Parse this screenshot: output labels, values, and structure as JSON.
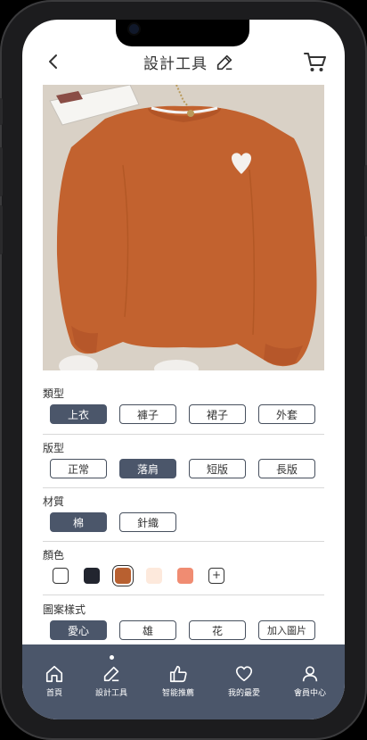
{
  "header": {
    "title": "設計工具"
  },
  "sections": [
    {
      "label": "類型",
      "options": [
        "上衣",
        "褲子",
        "裙子",
        "外套"
      ],
      "selected": 0
    },
    {
      "label": "版型",
      "options": [
        "正常",
        "落肩",
        "短版",
        "長版"
      ],
      "selected": 1
    },
    {
      "label": "材質",
      "options": [
        "棉",
        "針織"
      ],
      "selected": 0
    },
    {
      "label": "圖案樣式",
      "options": [
        "愛心",
        "雄",
        "花",
        "加入圖片"
      ],
      "selected": 0
    }
  ],
  "color": {
    "label": "顏色",
    "swatches": [
      "#ffffff",
      "#22252f",
      "#b86030",
      "#fde9dc",
      "#f08c72"
    ],
    "selected": 2,
    "add_symbol": "+"
  },
  "product": {
    "garment_color": "#c2622f",
    "heart_color": "#f4f1ee"
  },
  "tabbar": {
    "tabs": [
      "首頁",
      "設計工具",
      "智能推薦",
      "我的最愛",
      "會員中心"
    ],
    "active": 1
  },
  "colors": {
    "accent": "#4b566a"
  }
}
